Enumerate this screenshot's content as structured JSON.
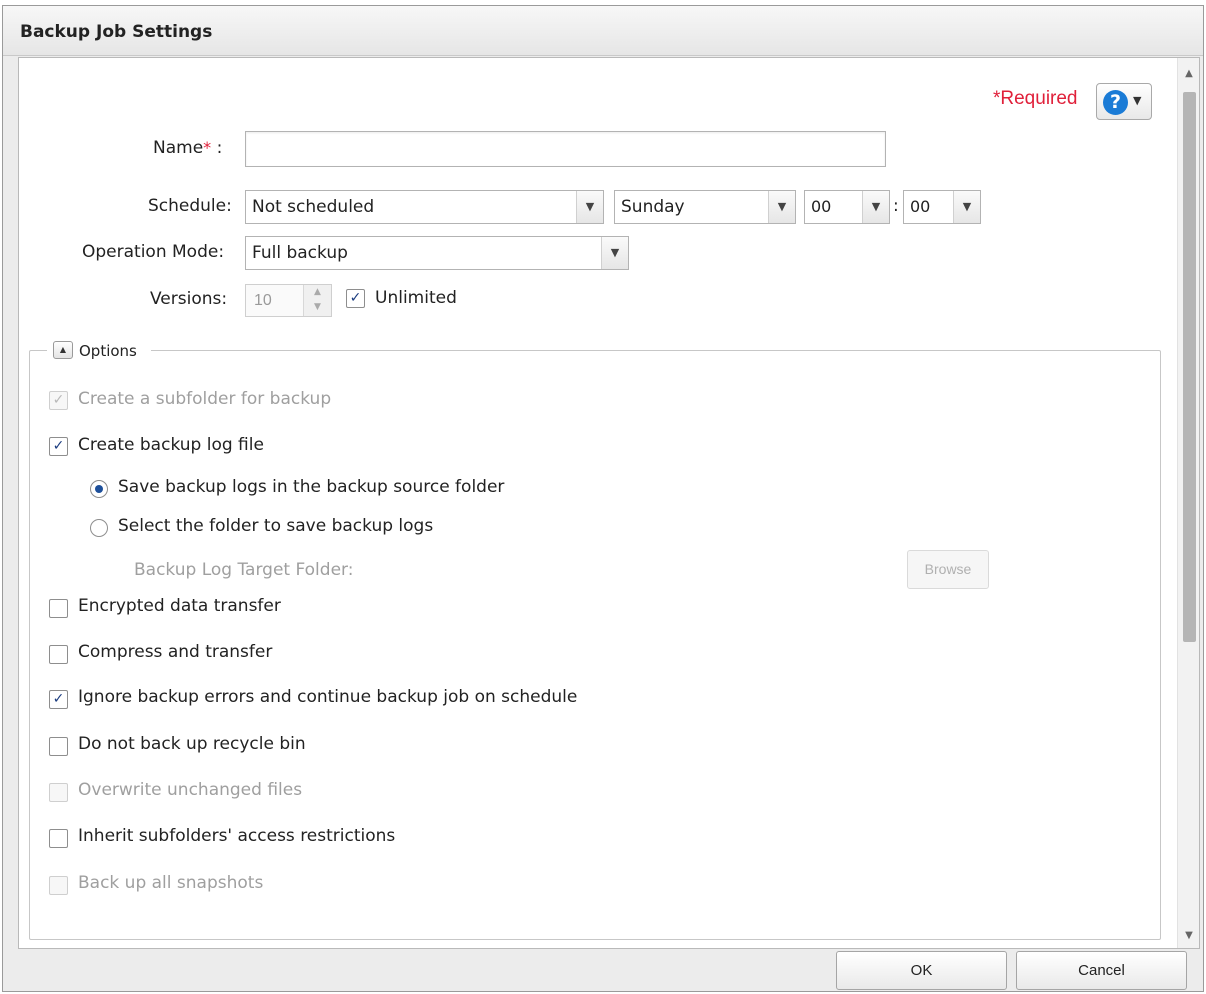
{
  "dialog": {
    "title": "Backup Job Settings",
    "required_label": "*Required",
    "help_icon": "question-circle-icon"
  },
  "form": {
    "name_label": "Name",
    "name_required_mark": "*",
    "name_colon": ":",
    "name_value": "",
    "schedule_label": "Schedule:",
    "schedule_value": "Not scheduled",
    "day_value": "Sunday",
    "hour_value": "00",
    "time_separator": ":",
    "minute_value": "00",
    "mode_label": "Operation Mode:",
    "mode_value": "Full backup",
    "versions_label": "Versions:",
    "versions_value": "10",
    "unlimited_label": "Unlimited",
    "unlimited_checked": true
  },
  "options": {
    "legend": "Options",
    "items": [
      {
        "label": "Create a subfolder for backup",
        "checked": true,
        "disabled": true
      },
      {
        "label": "Create backup log file",
        "checked": true,
        "disabled": false
      },
      {
        "label": "Save backup logs in the backup source folder",
        "selected": true
      },
      {
        "label": "Select the folder to save backup logs",
        "selected": false
      },
      {
        "label": "Backup Log Target Folder:"
      },
      {
        "label": "Encrypted data transfer",
        "checked": false,
        "disabled": false
      },
      {
        "label": "Compress and transfer",
        "checked": false,
        "disabled": false
      },
      {
        "label": "Ignore backup errors and continue backup job on schedule",
        "checked": true,
        "disabled": false
      },
      {
        "label": "Do not back up recycle bin",
        "checked": false,
        "disabled": false
      },
      {
        "label": "Overwrite unchanged files",
        "checked": false,
        "disabled": true
      },
      {
        "label": "Inherit subfolders' access restrictions",
        "checked": false,
        "disabled": false
      },
      {
        "label": "Back up all snapshots",
        "checked": false,
        "disabled": true
      }
    ],
    "browse_label": "Browse"
  },
  "footer": {
    "ok_label": "OK",
    "cancel_label": "Cancel"
  },
  "colors": {
    "required": "#e0203a",
    "help_icon": "#1a7bd6",
    "check_mark": "#1c3d80"
  }
}
